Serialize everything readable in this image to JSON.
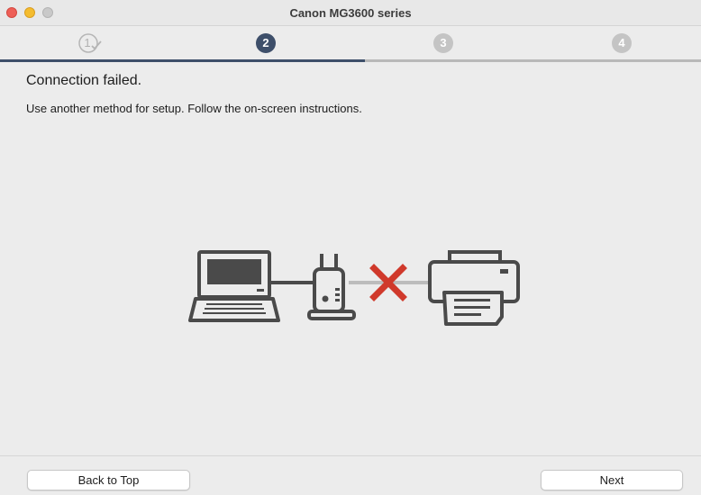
{
  "window": {
    "title": "Canon MG3600 series"
  },
  "steps": {
    "items": [
      {
        "label": "1",
        "state": "done"
      },
      {
        "label": "2",
        "state": "current"
      },
      {
        "label": "3",
        "state": "pending"
      },
      {
        "label": "4",
        "state": "pending"
      }
    ],
    "progress_fraction": 0.5
  },
  "main": {
    "heading": "Connection failed.",
    "instructions": "Use another method for setup. Follow the on-screen instructions."
  },
  "illustration": {
    "icons": [
      "laptop-icon",
      "router-icon",
      "error-x-icon",
      "printer-icon"
    ]
  },
  "footer": {
    "back_label": "Back to Top",
    "next_label": "Next"
  },
  "colors": {
    "accent": "#3e4f6a",
    "error": "#d0392b",
    "icon": "#4a4a4a"
  }
}
